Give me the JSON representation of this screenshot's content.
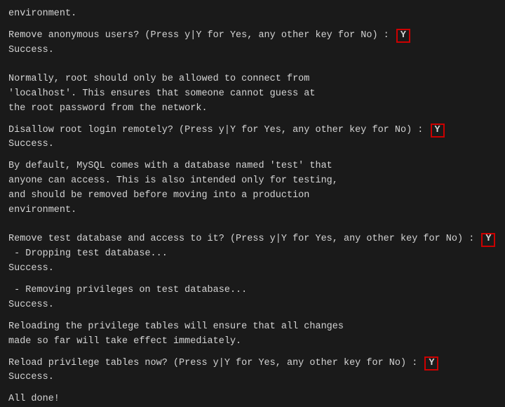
{
  "terminal": {
    "lines": [
      {
        "type": "text",
        "content": "environment."
      },
      {
        "type": "spacer"
      },
      {
        "type": "prompt",
        "text": "Remove anonymous users? (Press y|Y for Yes, any other key for No) : ",
        "response": "Y"
      },
      {
        "type": "text",
        "content": "Success."
      },
      {
        "type": "spacer"
      },
      {
        "type": "spacer"
      },
      {
        "type": "text",
        "content": "Normally, root should only be allowed to connect from"
      },
      {
        "type": "text",
        "content": "'localhost'. This ensures that someone cannot guess at"
      },
      {
        "type": "text",
        "content": "the root password from the network."
      },
      {
        "type": "spacer"
      },
      {
        "type": "prompt",
        "text": "Disallow root login remotely? (Press y|Y for Yes, any other key for No) : ",
        "response": "Y"
      },
      {
        "type": "text",
        "content": "Success."
      },
      {
        "type": "spacer"
      },
      {
        "type": "text",
        "content": "By default, MySQL comes with a database named 'test' that"
      },
      {
        "type": "text",
        "content": "anyone can access. This is also intended only for testing,"
      },
      {
        "type": "text",
        "content": "and should be removed before moving into a production"
      },
      {
        "type": "text",
        "content": "environment."
      },
      {
        "type": "spacer"
      },
      {
        "type": "spacer"
      },
      {
        "type": "prompt",
        "text": "Remove test database and access to it? (Press y|Y for Yes, any other key for No) : ",
        "response": "Y"
      },
      {
        "type": "text",
        "content": " - Dropping test database..."
      },
      {
        "type": "text",
        "content": "Success."
      },
      {
        "type": "spacer"
      },
      {
        "type": "text",
        "content": " - Removing privileges on test database..."
      },
      {
        "type": "text",
        "content": "Success."
      },
      {
        "type": "spacer"
      },
      {
        "type": "text",
        "content": "Reloading the privilege tables will ensure that all changes"
      },
      {
        "type": "text",
        "content": "made so far will take effect immediately."
      },
      {
        "type": "spacer"
      },
      {
        "type": "prompt",
        "text": "Reload privilege tables now? (Press y|Y for Yes, any other key for No) : ",
        "response": "Y"
      },
      {
        "type": "text",
        "content": "Success."
      },
      {
        "type": "spacer"
      },
      {
        "type": "text",
        "content": "All done!"
      }
    ]
  }
}
